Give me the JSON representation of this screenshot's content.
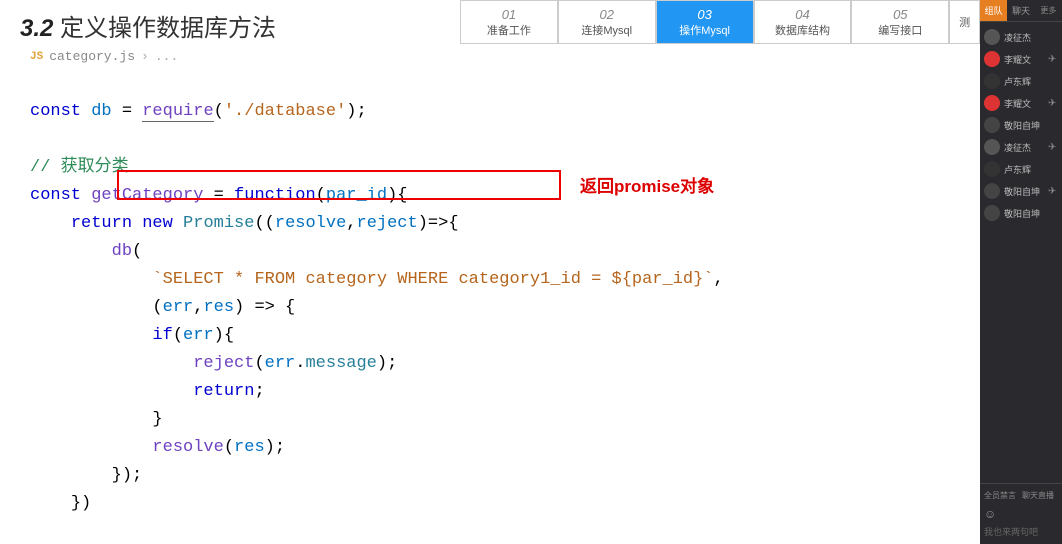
{
  "header": {
    "num": "3.2",
    "title": "定义操作数据库方法"
  },
  "tabs": [
    {
      "num": "01",
      "label": "准备工作"
    },
    {
      "num": "02",
      "label": "连接Mysql"
    },
    {
      "num": "03",
      "label": "操作Mysql"
    },
    {
      "num": "04",
      "label": "数据库结构"
    },
    {
      "num": "05",
      "label": "编写接口"
    },
    {
      "num": "",
      "label": "测"
    }
  ],
  "breadcrumb": {
    "icon": "JS",
    "file": "category.js",
    "sep": "›",
    "rest": "..."
  },
  "code": {
    "l1_const": "const",
    "l1_db": "db",
    "l1_eq": " = ",
    "l1_req": "require",
    "l1_p1": "(",
    "l1_str": "'./database'",
    "l1_p2": ");",
    "l2_cm": "// 获取分类",
    "l3_const": "const",
    "l3_name": "getCategory",
    "l3_eq": " = ",
    "l3_fn": "function",
    "l3_p1": "(",
    "l3_arg": "par_id",
    "l3_p2": "){",
    "l4_ret": "return",
    "l4_new": "new",
    "l4_prom": "Promise",
    "l4_p1": "((",
    "l4_a1": "resolve",
    "l4_c": ",",
    "l4_a2": "reject",
    "l4_p2": ")=>{",
    "l5_db": "db",
    "l5_p": "(",
    "l6_str": "`SELECT * FROM category WHERE category1_id = ${par_id}`",
    "l6_c": ",",
    "l7_p1": "(",
    "l7_err": "err",
    "l7_c": ",",
    "l7_res": "res",
    "l7_p2": ") => {",
    "l8_if": "if",
    "l8_p1": "(",
    "l8_err": "err",
    "l8_p2": "){",
    "l9_rej": "reject",
    "l9_p1": "(",
    "l9_err": "err",
    "l9_dot": ".",
    "l9_msg": "message",
    "l9_p2": ");",
    "l10_ret": "return",
    "l10_sc": ";",
    "l11": "}",
    "l12_res": "resolve",
    "l12_p1": "(",
    "l12_arg": "res",
    "l12_p2": ");",
    "l13": "});",
    "l14": "})"
  },
  "annotation": "返回promise对象",
  "sidebar": {
    "tabs": [
      "组队",
      "聊天",
      "更多"
    ],
    "users": [
      {
        "name": "凌征杰",
        "color": "#555"
      },
      {
        "name": "李耀文",
        "color": "#d33"
      },
      {
        "name": "卢东辉",
        "color": "#333"
      },
      {
        "name": "李耀文",
        "color": "#d33"
      },
      {
        "name": "敬阳自坤",
        "color": "#444"
      },
      {
        "name": "凌征杰",
        "color": "#555"
      },
      {
        "name": "卢东辉",
        "color": "#333"
      },
      {
        "name": "敬阳自坤",
        "color": "#444"
      },
      {
        "name": "敬阳自坤",
        "color": "#444"
      }
    ],
    "opt1": "全员禁言",
    "opt2": "聊天直播",
    "placeholder": "我也来两句吧"
  }
}
